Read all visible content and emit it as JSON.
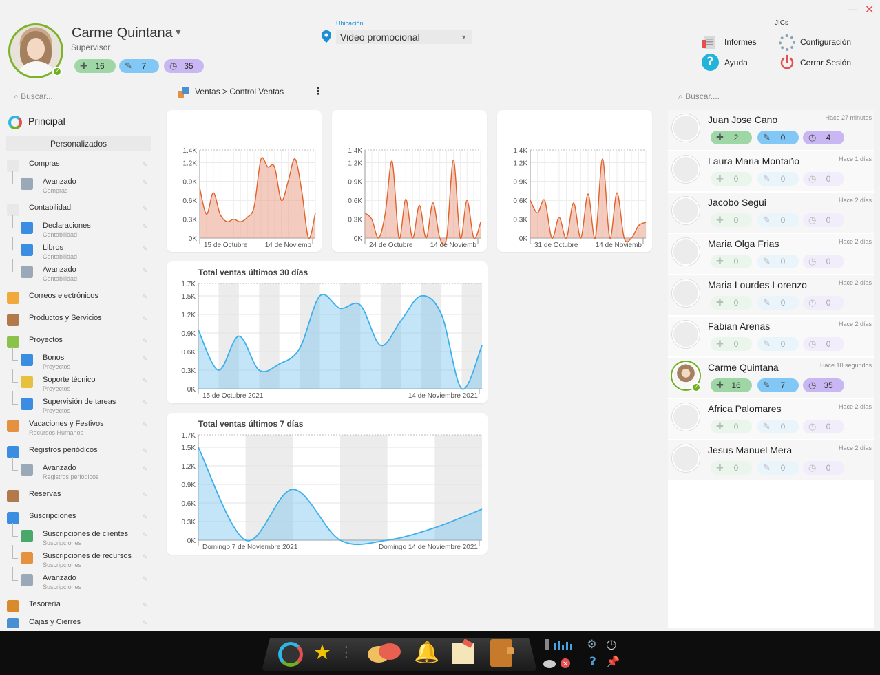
{
  "window": {
    "minimize": "—",
    "close": "✕"
  },
  "profile": {
    "name": "Carme Quintana",
    "role": "Supervisor",
    "badges": [
      {
        "value": "16"
      },
      {
        "value": "7"
      },
      {
        "value": "35"
      }
    ]
  },
  "location": {
    "label": "Ubicación",
    "value": "Video promocional"
  },
  "jics": {
    "title": "JICs",
    "informes": "Informes",
    "configuracion": "Configuración",
    "ayuda": "Ayuda",
    "cerrar": "Cerrar Sesión"
  },
  "search": {
    "left_placeholder": "Buscar....",
    "right_placeholder": "Buscar...."
  },
  "breadcrumb": "Ventas > Control Ventas",
  "sidebar": {
    "principal": "Principal",
    "personalizados": "Personalizados",
    "items": [
      {
        "label": "Compras"
      },
      {
        "label": "Avanzado",
        "sub": "Compras"
      },
      {
        "label": "Contabilidad"
      },
      {
        "label": "Declaraciones",
        "sub": "Contabilidad"
      },
      {
        "label": "Libros",
        "sub": "Contabilidad"
      },
      {
        "label": "Avanzado",
        "sub": "Contabilidad"
      },
      {
        "label": "Correos electrónicos"
      },
      {
        "label": "Productos y Servicios"
      },
      {
        "label": "Proyectos"
      },
      {
        "label": "Bonos",
        "sub": "Proyectos"
      },
      {
        "label": "Soporte técnico",
        "sub": "Proyectos"
      },
      {
        "label": "Supervisión de tareas",
        "sub": "Proyectos"
      },
      {
        "label": "Vacaciones y Festivos",
        "sub": "Recursos Humanos"
      },
      {
        "label": "Registros periódicos"
      },
      {
        "label": "Avanzado",
        "sub": "Registros periódicos"
      },
      {
        "label": "Reservas"
      },
      {
        "label": "Suscripciones"
      },
      {
        "label": "Suscripciones de clientes",
        "sub": "Suscripciones"
      },
      {
        "label": "Suscripciones de recursos",
        "sub": "Suscripciones"
      },
      {
        "label": "Avanzado",
        "sub": "Suscripciones"
      },
      {
        "label": "Tesorería"
      },
      {
        "label": "Cajas y Cierres"
      }
    ]
  },
  "colors": {
    "accent": "#1a8fd8",
    "orange": "#e0622a",
    "blue": "#4bb7ea",
    "green": "#6fb01f"
  },
  "chart_data": [
    {
      "type": "area",
      "title": "",
      "yticks": [
        "0K",
        "0.3K",
        "0.6K",
        "0.9K",
        "1.2K",
        "1.4K"
      ],
      "ylim": [
        0,
        1400
      ],
      "xticks": [
        "15 de Octubre",
        "14 de Noviemb"
      ],
      "series": [
        {
          "values": [
            800,
            380,
            720,
            380,
            260,
            300,
            260,
            330,
            500,
            1250,
            1130,
            1130,
            600,
            900,
            1260,
            750,
            0,
            400
          ]
        }
      ]
    },
    {
      "type": "area",
      "title": "",
      "yticks": [
        "0K",
        "0.3K",
        "0.6K",
        "0.9K",
        "1.2K",
        "1.4K"
      ],
      "ylim": [
        0,
        1400
      ],
      "xticks": [
        "24 de Octubre",
        "14 de Noviemb"
      ],
      "series": [
        {
          "values": [
            400,
            300,
            0,
            400,
            1220,
            0,
            620,
            0,
            520,
            0,
            560,
            0,
            0,
            1240,
            0,
            600,
            0,
            250
          ]
        }
      ]
    },
    {
      "type": "area",
      "title": "",
      "yticks": [
        "0K",
        "0.3K",
        "0.6K",
        "0.9K",
        "1.2K",
        "1.4K"
      ],
      "ylim": [
        0,
        1400
      ],
      "xticks": [
        "31 de Octubre",
        "14 de Noviemb"
      ],
      "series": [
        {
          "values": [
            600,
            400,
            600,
            0,
            330,
            0,
            560,
            0,
            700,
            0,
            1260,
            0,
            720,
            0,
            0,
            200,
            250
          ]
        }
      ]
    },
    {
      "type": "area",
      "title": "Total ventas últimos 30 días",
      "yticks": [
        "0K",
        "0.3K",
        "0.6K",
        "0.9K",
        "1.2K",
        "1.5K",
        "1.7K"
      ],
      "ylim": [
        0,
        1700
      ],
      "xticks": [
        "15 de Octubre 2021",
        "14 de Noviembre 2021"
      ],
      "series": [
        {
          "values": [
            950,
            300,
            850,
            300,
            400,
            650,
            1500,
            1300,
            1350,
            700,
            1100,
            1500,
            1200,
            0,
            700
          ]
        }
      ]
    },
    {
      "type": "area",
      "title": "Total ventas últimos 7 días",
      "yticks": [
        "0K",
        "0.3K",
        "0.6K",
        "0.9K",
        "1.2K",
        "1.5K",
        "1.7K"
      ],
      "ylim": [
        0,
        1700
      ],
      "xticks": [
        "Domingo 7 de Noviembre 2021",
        "Domingo 14 de Noviembre 2021"
      ],
      "series": [
        {
          "values": [
            1500,
            0,
            820,
            0,
            0,
            200,
            500
          ]
        }
      ]
    }
  ],
  "users": [
    {
      "name": "Juan Jose Cano",
      "time": "Hace 27 minutos",
      "a": "2",
      "b": "0",
      "c": "4",
      "active": true
    },
    {
      "name": "Laura Maria Montaño",
      "time": "Hace 1 días",
      "a": "0",
      "b": "0",
      "c": "0",
      "active": false
    },
    {
      "name": "Jacobo Segui",
      "time": "Hace 2 días",
      "a": "0",
      "b": "0",
      "c": "0",
      "active": false
    },
    {
      "name": "Maria Olga Frias",
      "time": "Hace 2 días",
      "a": "0",
      "b": "0",
      "c": "0",
      "active": false
    },
    {
      "name": "Maria Lourdes Lorenzo",
      "time": "Hace 2 días",
      "a": "0",
      "b": "0",
      "c": "0",
      "active": false
    },
    {
      "name": "Fabian Arenas",
      "time": "Hace 2 días",
      "a": "0",
      "b": "0",
      "c": "0",
      "active": false
    },
    {
      "name": "Carme Quintana",
      "time": "Hace 10 segundos",
      "a": "16",
      "b": "7",
      "c": "35",
      "active": true
    },
    {
      "name": "Africa Palomares",
      "time": "Hace 2 días",
      "a": "0",
      "b": "0",
      "c": "0",
      "active": false
    },
    {
      "name": "Jesus Manuel Mera",
      "time": "Hace 2 días",
      "a": "0",
      "b": "0",
      "c": "0",
      "active": false
    }
  ]
}
